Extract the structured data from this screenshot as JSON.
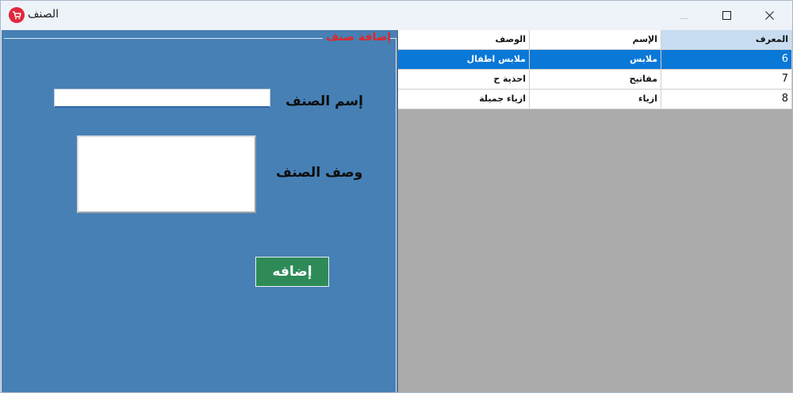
{
  "window": {
    "title": "الصنف",
    "icon": "cart-icon",
    "controls": {
      "minimize": "minimize-icon",
      "maximize": "maximize-icon",
      "close": "close-icon"
    }
  },
  "form": {
    "group_title": "إضافة صنف",
    "name_label": "إسم الصنف",
    "name_value": "",
    "desc_label": "وصف الصنف",
    "desc_value": "",
    "add_button": "إضافه"
  },
  "grid": {
    "columns": [
      "المعرف",
      "الإسم",
      "الوصف"
    ],
    "rows": [
      {
        "id": "6",
        "name": "ملابس",
        "desc": "ملابس اطفال",
        "selected": true
      },
      {
        "id": "7",
        "name": "مفاتيح",
        "desc": "احذية ح",
        "selected": false
      },
      {
        "id": "8",
        "name": "ازياء",
        "desc": "ازياء جميلة",
        "selected": false
      }
    ]
  },
  "colors": {
    "panel": "#4680b5",
    "group_title": "#e32626",
    "add_button": "#2e8b57",
    "selection": "#0a78d7",
    "grid_background": "#abaaab",
    "header_highlight": "#c8ddf1"
  }
}
